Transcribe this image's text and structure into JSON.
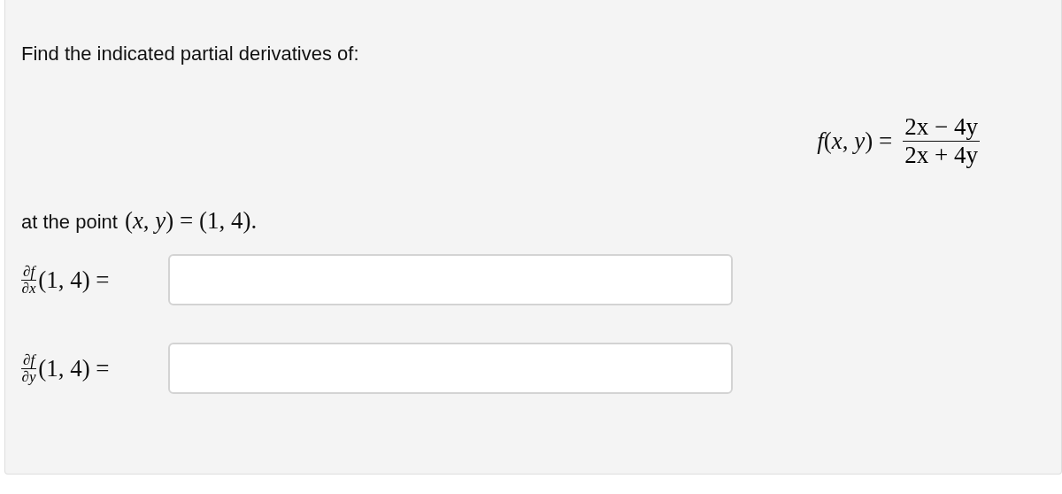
{
  "prompt": "Find the indicated partial derivatives of:",
  "function": {
    "lhs": "*f*(*x*, *y*) =",
    "numerator": "2x − 4y",
    "denominator": "2x + 4y"
  },
  "point": {
    "text": "at the point",
    "math": "(*x*, *y*) = (1, 4)."
  },
  "answers": [
    {
      "numerator": "∂*f*",
      "denominator": "∂*x*",
      "rest": "(1, 4) ="
    },
    {
      "numerator": "∂*f*",
      "denominator": "∂*y*",
      "rest": "(1, 4) ="
    }
  ]
}
